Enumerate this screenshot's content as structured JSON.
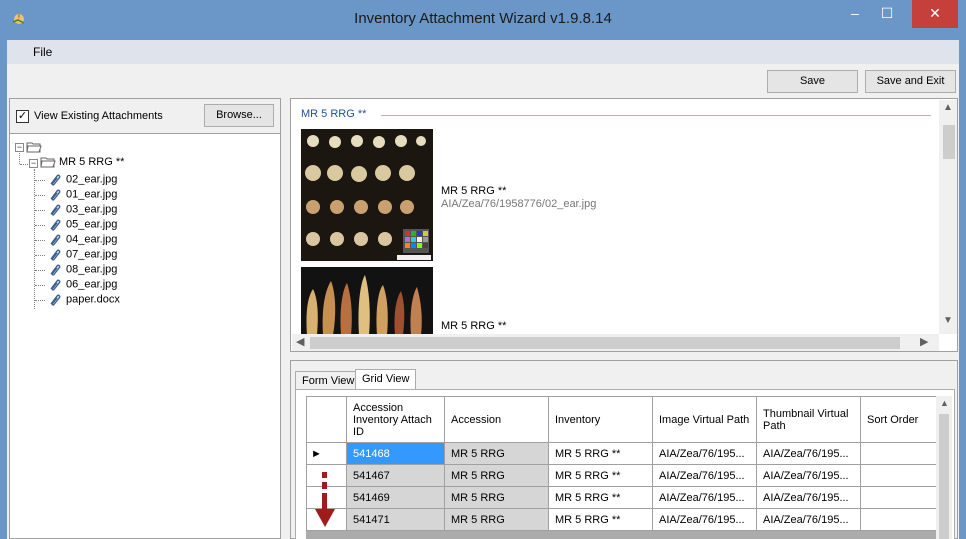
{
  "window": {
    "title": "Inventory Attachment Wizard v1.9.8.14",
    "controls": {
      "minimize": "–",
      "maximize": "☐",
      "close": "✕"
    }
  },
  "menu": {
    "file": "File"
  },
  "toolbar": {
    "save": "Save",
    "save_and_exit": "Save and Exit"
  },
  "left_panel": {
    "view_existing_checked": true,
    "view_existing_label": "View Existing Attachments",
    "browse_label": "Browse...",
    "tree": {
      "root_label": "",
      "node_label": "MR 5 RRG **",
      "children": [
        "02_ear.jpg",
        "01_ear.jpg",
        "03_ear.jpg",
        "05_ear.jpg",
        "04_ear.jpg",
        "07_ear.jpg",
        "08_ear.jpg",
        "06_ear.jpg",
        "paper.docx"
      ]
    }
  },
  "preview": {
    "group_title": "MR 5 RRG **",
    "items": [
      {
        "caption": "MR 5 RRG **",
        "path": "AIA/Zea/76/1958776/02_ear.jpg"
      },
      {
        "caption": "MR 5 RRG **",
        "path": ""
      }
    ]
  },
  "tabs": {
    "form_view": "Form View",
    "grid_view": "Grid View"
  },
  "grid": {
    "columns": [
      "",
      "Accession Inventory Attach ID",
      "Accession",
      "Inventory",
      "Image Virtual Path",
      "Thumbnail Virtual Path",
      "Sort Order"
    ],
    "row_indicator": "►",
    "rows": [
      {
        "id": "541468",
        "accession": "MR 5 RRG",
        "inventory": "MR 5 RRG **",
        "image_path": "AIA/Zea/76/195...",
        "thumb_path": "AIA/Zea/76/195...",
        "sort_order": ""
      },
      {
        "id": "541467",
        "accession": "MR 5 RRG",
        "inventory": "MR 5 RRG **",
        "image_path": "AIA/Zea/76/195...",
        "thumb_path": "AIA/Zea/76/195...",
        "sort_order": ""
      },
      {
        "id": "541469",
        "accession": "MR 5 RRG",
        "inventory": "MR 5 RRG **",
        "image_path": "AIA/Zea/76/195...",
        "thumb_path": "AIA/Zea/76/195...",
        "sort_order": ""
      },
      {
        "id": "541471",
        "accession": "MR 5 RRG",
        "inventory": "MR 5 RRG **",
        "image_path": "AIA/Zea/76/195...",
        "thumb_path": "AIA/Zea/76/195...",
        "sort_order": ""
      }
    ]
  },
  "colors": {
    "titlebar": "#6b96c8",
    "close_button": "#c6403b",
    "selection": "#3399ff",
    "group_title": "#1f4f9c",
    "drag_arrow": "#a01c1c"
  },
  "icons": {
    "app": "app-icon",
    "folder": "folder-icon",
    "attachment": "paperclip-icon",
    "drag": "drag-down-arrow-icon"
  }
}
